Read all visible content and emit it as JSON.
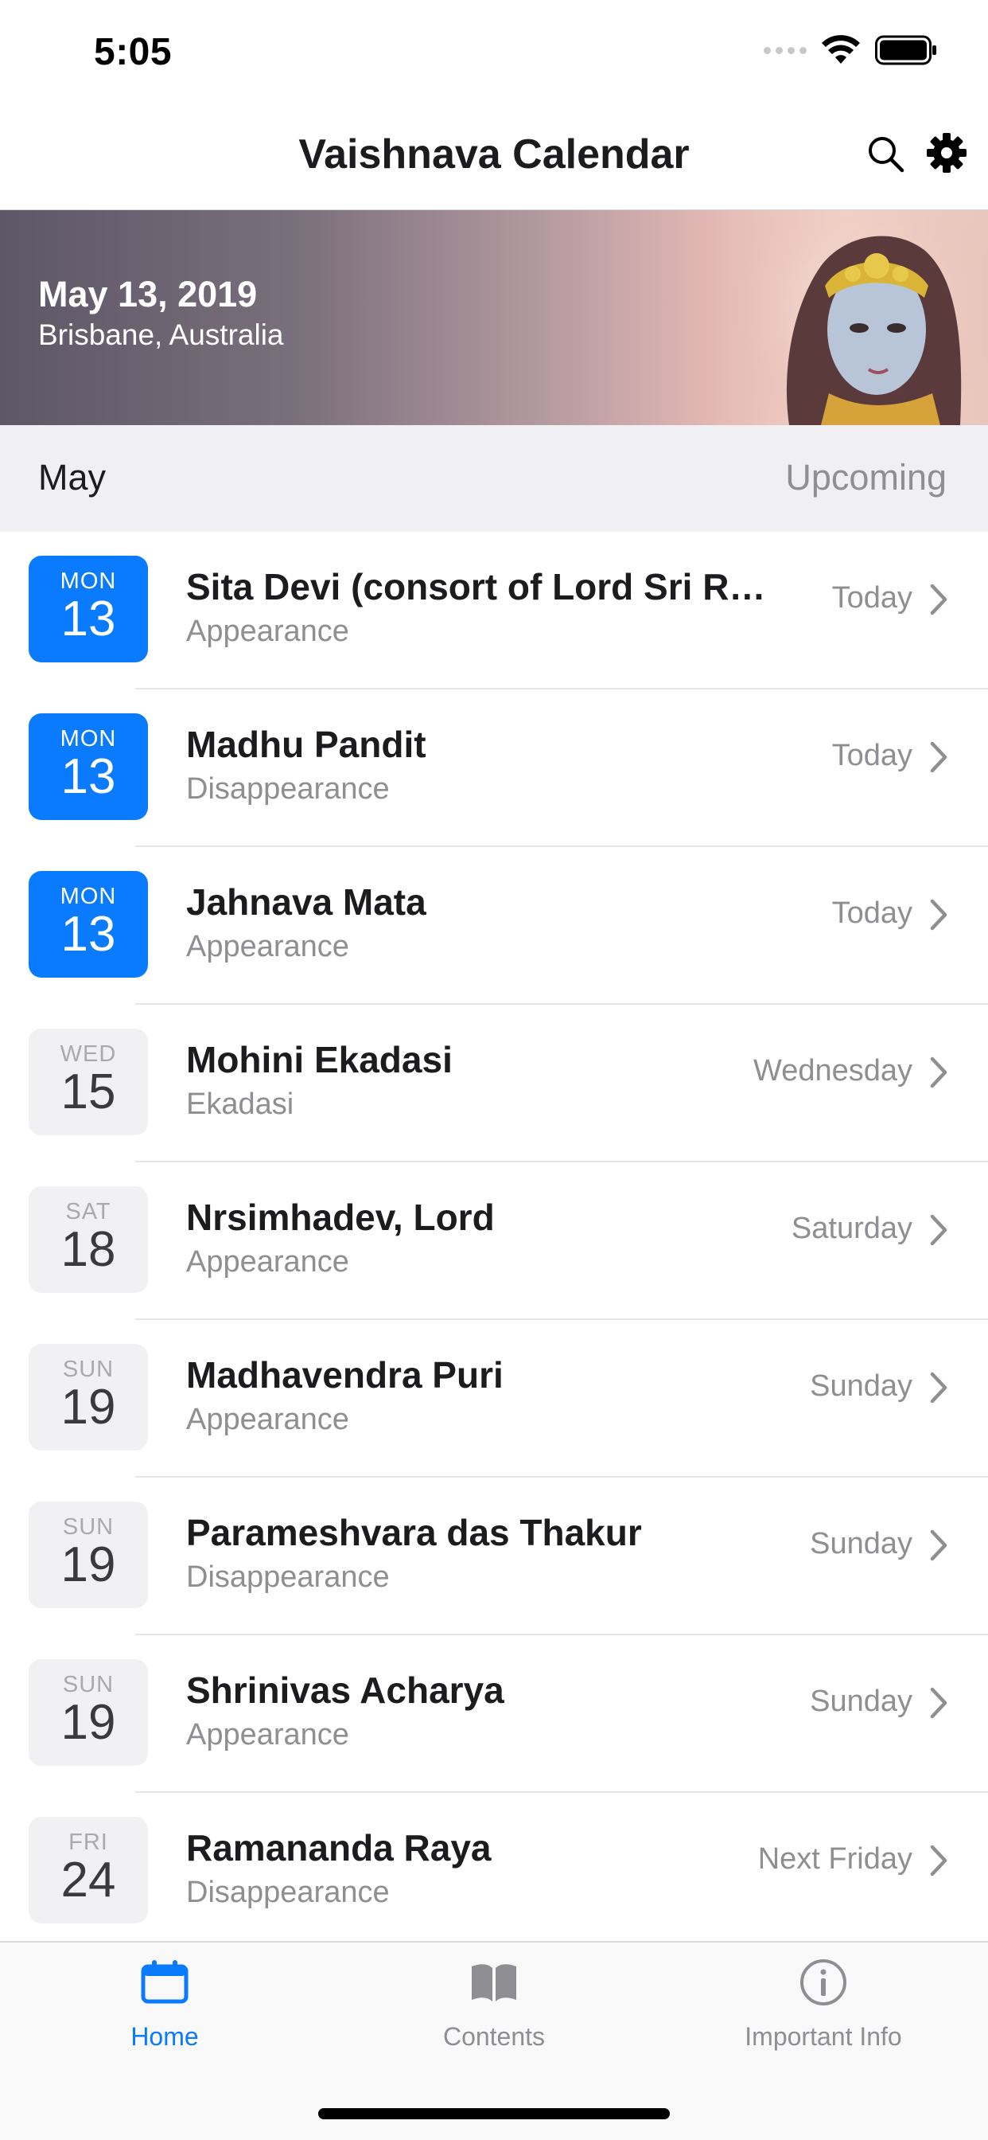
{
  "status_bar": {
    "time": "5:05"
  },
  "nav": {
    "title": "Vaishnava Calendar"
  },
  "banner": {
    "date": "May 13, 2019",
    "location": "Brisbane, Australia"
  },
  "section": {
    "month": "May",
    "upcoming": "Upcoming"
  },
  "events": [
    {
      "dow": "MON",
      "day": "13",
      "today": true,
      "title": "Sita Devi (consort of Lord Sri Rama)",
      "type": "Appearance",
      "when": "Today"
    },
    {
      "dow": "MON",
      "day": "13",
      "today": true,
      "title": "Madhu Pandit",
      "type": "Disappearance",
      "when": "Today"
    },
    {
      "dow": "MON",
      "day": "13",
      "today": true,
      "title": "Jahnava Mata",
      "type": "Appearance",
      "when": "Today"
    },
    {
      "dow": "WED",
      "day": "15",
      "today": false,
      "title": "Mohini Ekadasi",
      "type": "Ekadasi",
      "when": "Wednesday"
    },
    {
      "dow": "SAT",
      "day": "18",
      "today": false,
      "title": "Nrsimhadev, Lord",
      "type": "Appearance",
      "when": "Saturday"
    },
    {
      "dow": "SUN",
      "day": "19",
      "today": false,
      "title": "Madhavendra Puri",
      "type": "Appearance",
      "when": "Sunday"
    },
    {
      "dow": "SUN",
      "day": "19",
      "today": false,
      "title": "Parameshvara das Thakur",
      "type": "Disappearance",
      "when": "Sunday"
    },
    {
      "dow": "SUN",
      "day": "19",
      "today": false,
      "title": "Shrinivas Acharya",
      "type": "Appearance",
      "when": "Sunday"
    },
    {
      "dow": "FRI",
      "day": "24",
      "today": false,
      "title": "Ramananda Raya",
      "type": "Disappearance",
      "when": "Next Friday"
    }
  ],
  "tabs": [
    {
      "label": "Home",
      "icon": "calendar-icon",
      "active": true
    },
    {
      "label": "Contents",
      "icon": "book-icon",
      "active": false
    },
    {
      "label": "Important Info",
      "icon": "info-icon",
      "active": false
    }
  ],
  "colors": {
    "accent": "#0a7bff",
    "secondary_text": "#8e8e93",
    "section_bg": "#efeff4"
  }
}
